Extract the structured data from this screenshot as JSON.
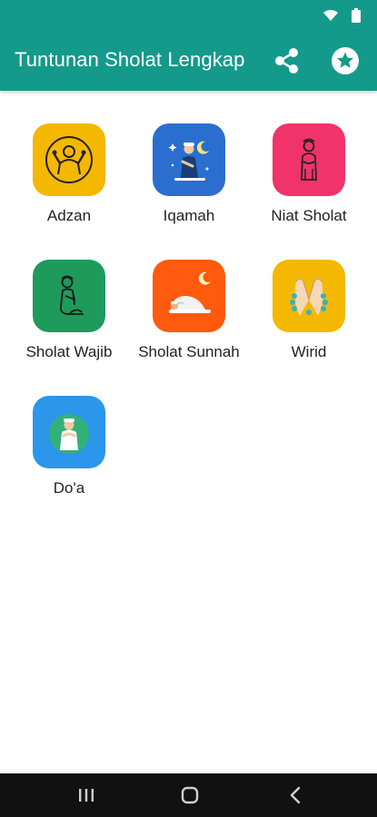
{
  "app_bar": {
    "title": "Tuntunan Sholat Lengkap",
    "background": "#139a8a",
    "actions": [
      "share-icon",
      "star-icon"
    ]
  },
  "status_bar": {
    "icons": [
      "wifi-icon",
      "battery-icon"
    ]
  },
  "menu": [
    {
      "label": "Adzan",
      "icon": "muadhin-icon",
      "color": "#f5b800"
    },
    {
      "label": "Iqamah",
      "icon": "praying-man-night-icon",
      "color": "#2a6fd0"
    },
    {
      "label": "Niat Sholat",
      "icon": "standing-prayer-icon",
      "color": "#f0336a"
    },
    {
      "label": "Sholat Wajib",
      "icon": "kneeling-prayer-icon",
      "color": "#1e9a5a"
    },
    {
      "label": "Sholat Sunnah",
      "icon": "prostration-icon",
      "color": "#ff5a0d"
    },
    {
      "label": "Wirid",
      "icon": "prayer-beads-hands-icon",
      "color": "#f5b800"
    },
    {
      "label": "Do'a",
      "icon": "dua-icon",
      "color": "#2b96ea"
    }
  ],
  "nav": [
    "recent-apps-icon",
    "home-icon",
    "back-icon"
  ]
}
